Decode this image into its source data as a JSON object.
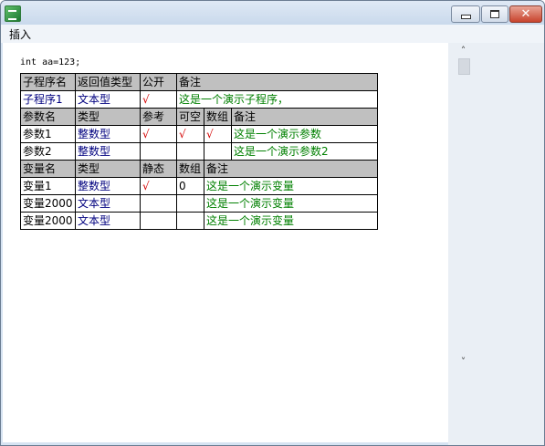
{
  "menu": {
    "insert": "插入"
  },
  "window_controls": {
    "minimize": "▭",
    "maximize": "□",
    "close": "✕"
  },
  "scroll_arrows": {
    "up": "˄",
    "down": "˅"
  },
  "document": {
    "code_line": "int aa=123;",
    "rows": [
      {
        "type": "header",
        "cells": [
          {
            "text": "子程序名"
          },
          {
            "text": "返回值类型"
          },
          {
            "text": "公开"
          },
          {
            "text": "备注",
            "colspan": 3
          }
        ]
      },
      {
        "type": "data",
        "cells": [
          {
            "text": "子程序1",
            "color": "blue"
          },
          {
            "text": "文本型",
            "color": "blue"
          },
          {
            "text": "√",
            "color": "check"
          },
          {
            "text": "这是一个演示子程序，",
            "color": "green",
            "colspan": 3
          }
        ]
      },
      {
        "type": "header",
        "cells": [
          {
            "text": "参数名"
          },
          {
            "text": "类型"
          },
          {
            "text": "参考"
          },
          {
            "text": "可空"
          },
          {
            "text": "数组"
          },
          {
            "text": "备注"
          }
        ]
      },
      {
        "type": "data",
        "cells": [
          {
            "text": "参数1"
          },
          {
            "text": "整数型",
            "color": "blue"
          },
          {
            "text": "√",
            "color": "check"
          },
          {
            "text": "√",
            "color": "check"
          },
          {
            "text": "√",
            "color": "check"
          },
          {
            "text": "这是一个演示参数",
            "color": "green"
          }
        ]
      },
      {
        "type": "data",
        "cells": [
          {
            "text": "参数2"
          },
          {
            "text": "整数型",
            "color": "blue"
          },
          {
            "text": ""
          },
          {
            "text": ""
          },
          {
            "text": ""
          },
          {
            "text": "这是一个演示参数2",
            "color": "green"
          }
        ]
      },
      {
        "type": "header",
        "cells": [
          {
            "text": "变量名"
          },
          {
            "text": "类型"
          },
          {
            "text": "静态"
          },
          {
            "text": "数组"
          },
          {
            "text": "备注",
            "colspan": 2
          }
        ]
      },
      {
        "type": "data",
        "cells": [
          {
            "text": "变量1"
          },
          {
            "text": "整数型",
            "color": "blue"
          },
          {
            "text": "√",
            "color": "check"
          },
          {
            "text": "0"
          },
          {
            "text": "这是一个演示变量",
            "color": "green",
            "colspan": 2
          }
        ]
      },
      {
        "type": "data",
        "cells": [
          {
            "text": "变量2000"
          },
          {
            "text": "文本型",
            "color": "blue"
          },
          {
            "text": ""
          },
          {
            "text": ""
          },
          {
            "text": "这是一个演示变量",
            "color": "green",
            "colspan": 2
          }
        ]
      },
      {
        "type": "data",
        "cells": [
          {
            "text": "变量2000"
          },
          {
            "text": "文本型",
            "color": "blue"
          },
          {
            "text": ""
          },
          {
            "text": ""
          },
          {
            "text": "这是一个演示变量",
            "color": "green",
            "colspan": 2
          }
        ]
      }
    ]
  }
}
